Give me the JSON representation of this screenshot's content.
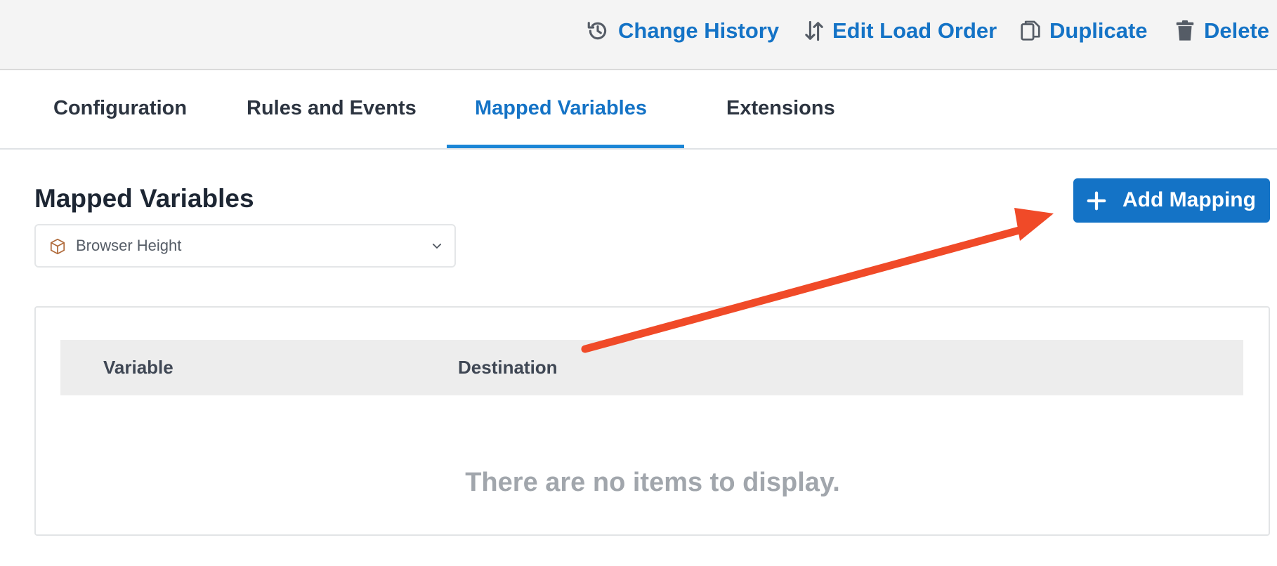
{
  "toolbar": {
    "change_history": "Change History",
    "edit_load_order": "Edit Load Order",
    "duplicate": "Duplicate",
    "delete": "Delete"
  },
  "tabs": [
    {
      "label": "Configuration",
      "active": false
    },
    {
      "label": "Rules and Events",
      "active": false
    },
    {
      "label": "Mapped Variables",
      "active": true
    },
    {
      "label": "Extensions",
      "active": false
    }
  ],
  "main": {
    "title": "Mapped Variables",
    "variable_select": {
      "value": "Browser Height",
      "icon": "cube-icon"
    },
    "add_button": "Add Mapping",
    "table": {
      "columns": [
        "Variable",
        "Destination"
      ],
      "rows": [],
      "empty_message": "There are no items to display."
    }
  },
  "colors": {
    "accent": "#1473c6",
    "annotation_arrow": "#f04a28",
    "topbar_bg": "#f4f4f4"
  }
}
